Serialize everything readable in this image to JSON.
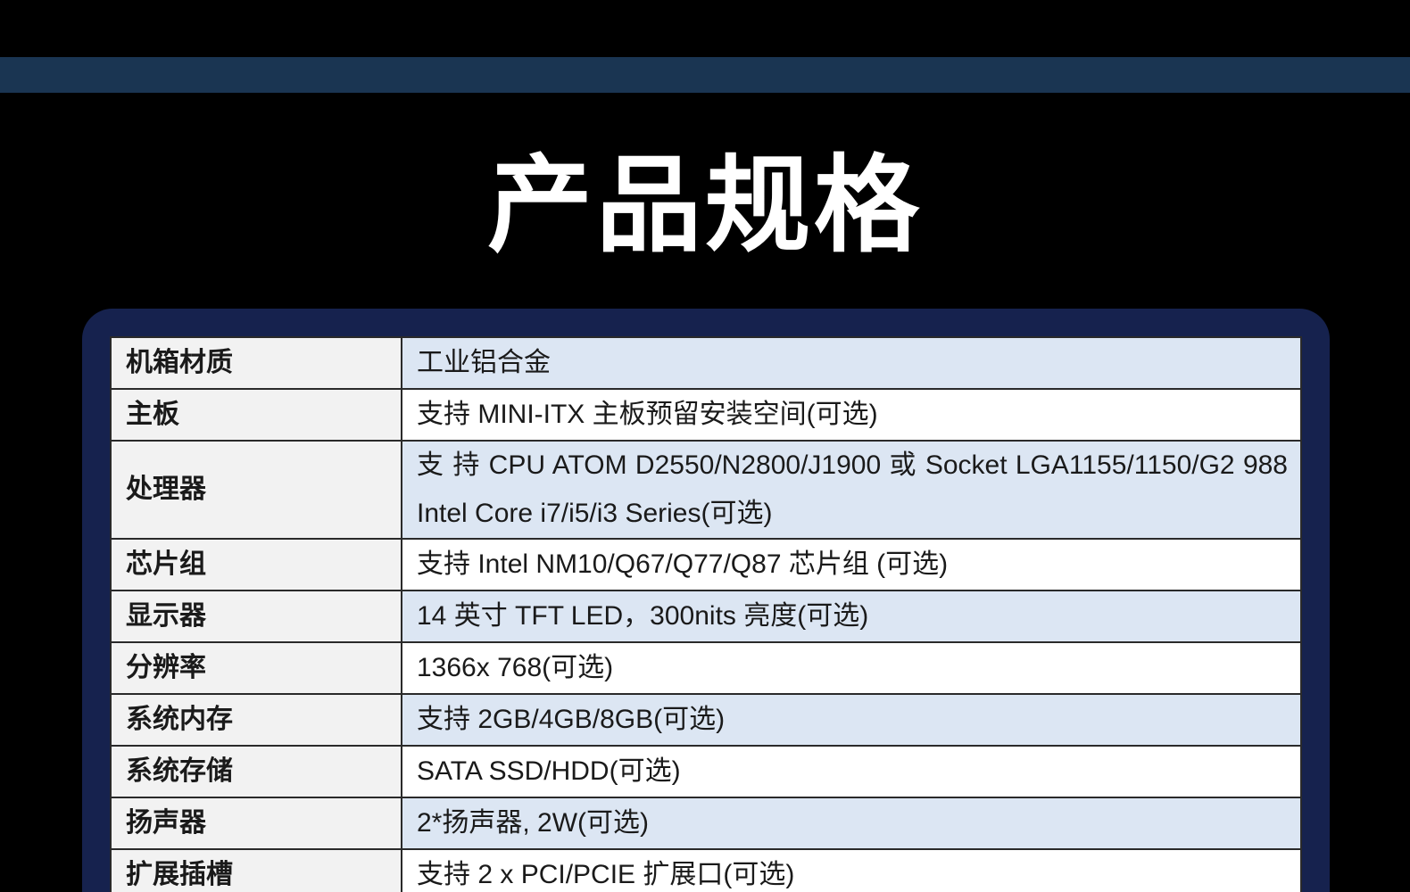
{
  "page": {
    "title": "产品规格"
  },
  "specs": [
    {
      "label": "机箱材质",
      "value": "工业铝合金"
    },
    {
      "label": "主板",
      "value": "支持 MINI-ITX  主板预留安装空间(可选)"
    },
    {
      "label": "处理器",
      "value": "支 持 CPU ATOM D2550/N2800/J1900 或 Socket LGA1155/1150/G2 988 Intel Core i7/i5/i3 Series(可选)"
    },
    {
      "label": "芯片组",
      "value": "支持 Intel NM10/Q67/Q77/Q87  芯片组 (可选)"
    },
    {
      "label": "显示器",
      "value": "14 英寸 TFT LED，300nits 亮度(可选)"
    },
    {
      "label": "分辨率",
      "value": "1366x 768(可选)"
    },
    {
      "label": "系统内存",
      "value": "支持 2GB/4GB/8GB(可选)"
    },
    {
      "label": "系统存储",
      "value": "SATA SSD/HDD(可选)"
    },
    {
      "label": "扬声器",
      "value": "2*扬声器, 2W(可选)"
    },
    {
      "label": "扩展插槽",
      "value": "支持 2 x PCI/PCIE 扩展口(可选)"
    }
  ],
  "colors": {
    "background": "#000000",
    "top_bar": "#1a3552",
    "panel": "#16224e",
    "row_alt": "#dce6f3",
    "label_cell": "#f2f2f2"
  }
}
